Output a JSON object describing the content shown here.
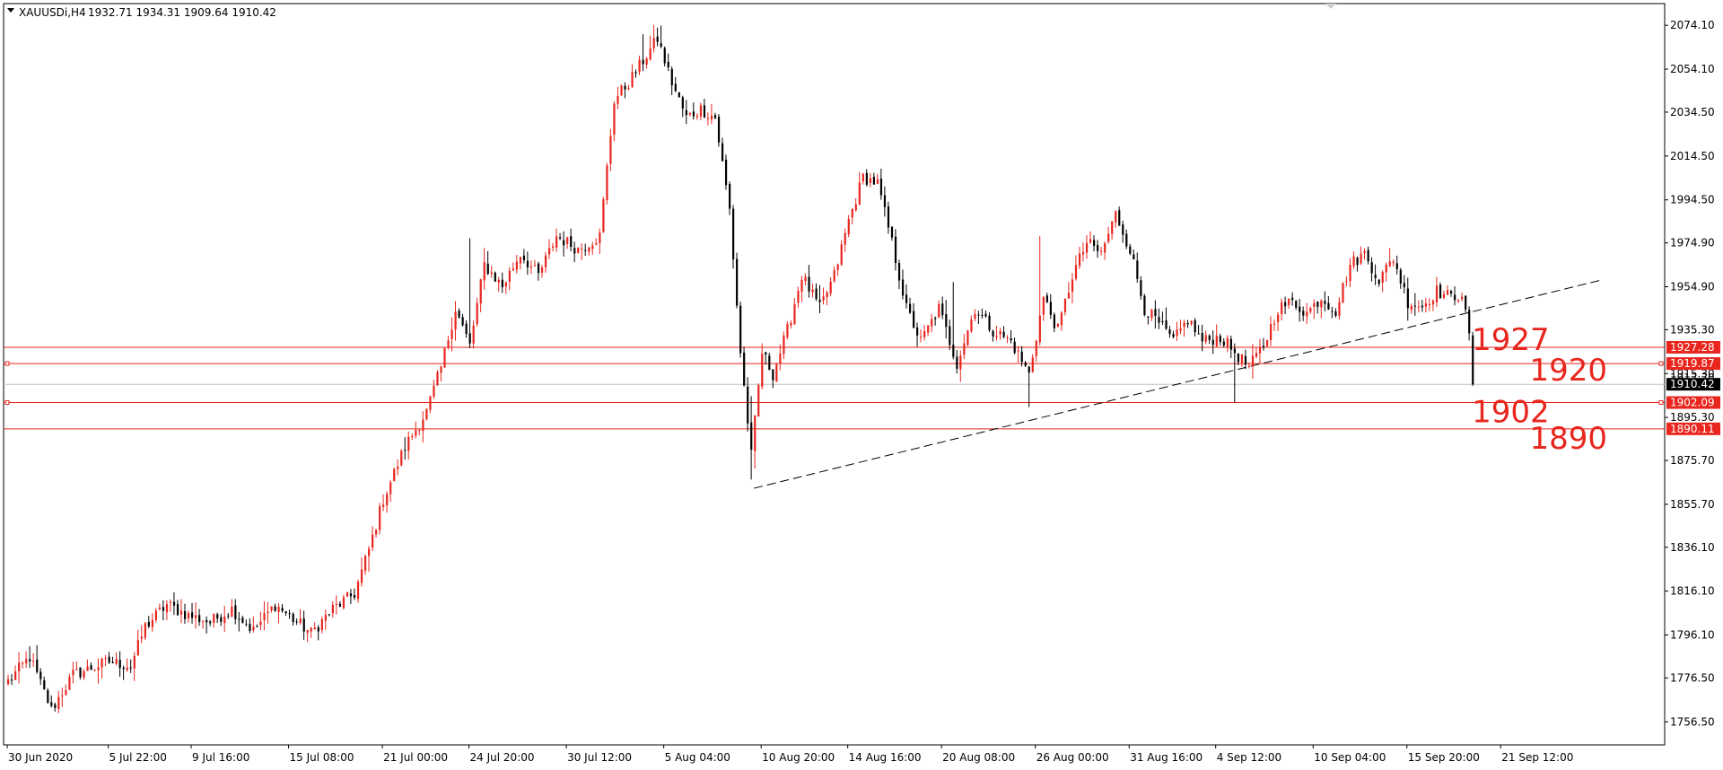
{
  "chart_data": {
    "type": "candlestick",
    "symbol_header": "XAUUSDi,H4",
    "ohlc_header": "1932.71 1934.31 1909.64 1910.42",
    "ylim": [
      1746.0,
      2084.0
    ],
    "y_ticks": [
      "2074.10",
      "2054.10",
      "2034.50",
      "2014.50",
      "1994.50",
      "1974.90",
      "1954.90",
      "1935.30",
      "1915.30",
      "1895.30",
      "1875.70",
      "1855.70",
      "1836.10",
      "1816.10",
      "1796.10",
      "1776.50",
      "1756.50"
    ],
    "x_ticks": [
      {
        "label": "30 Jun 2020",
        "bar": 0
      },
      {
        "label": "5 Jul 22:00",
        "bar": 28
      },
      {
        "label": "9 Jul 16:00",
        "bar": 51
      },
      {
        "label": "15 Jul 08:00",
        "bar": 78
      },
      {
        "label": "21 Jul 00:00",
        "bar": 104
      },
      {
        "label": "24 Jul 20:00",
        "bar": 128
      },
      {
        "label": "30 Jul 12:00",
        "bar": 155
      },
      {
        "label": "5 Aug 04:00",
        "bar": 182
      },
      {
        "label": "10 Aug 20:00",
        "bar": 209
      },
      {
        "label": "14 Aug 16:00",
        "bar": 233
      },
      {
        "label": "20 Aug 08:00",
        "bar": 259
      },
      {
        "label": "26 Aug 00:00",
        "bar": 285
      },
      {
        "label": "31 Aug 16:00",
        "bar": 311
      },
      {
        "label": "4 Sep 12:00",
        "bar": 335
      },
      {
        "label": "10 Sep 04:00",
        "bar": 362
      },
      {
        "label": "15 Sep 20:00",
        "bar": 388
      },
      {
        "label": "21 Sep 12:00",
        "bar": 414
      }
    ],
    "bar_count_visible": 450,
    "anchors": [
      {
        "i": 0,
        "p": 1775
      },
      {
        "i": 6,
        "p": 1786
      },
      {
        "i": 12,
        "p": 1762
      },
      {
        "i": 18,
        "p": 1778
      },
      {
        "i": 28,
        "p": 1784
      },
      {
        "i": 34,
        "p": 1782
      },
      {
        "i": 38,
        "p": 1800
      },
      {
        "i": 44,
        "p": 1810
      },
      {
        "i": 50,
        "p": 1805
      },
      {
        "i": 56,
        "p": 1802
      },
      {
        "i": 62,
        "p": 1808
      },
      {
        "i": 68,
        "p": 1798
      },
      {
        "i": 74,
        "p": 1810
      },
      {
        "i": 80,
        "p": 1802
      },
      {
        "i": 84,
        "p": 1797
      },
      {
        "i": 90,
        "p": 1808
      },
      {
        "i": 96,
        "p": 1815
      },
      {
        "i": 100,
        "p": 1835
      },
      {
        "i": 104,
        "p": 1858
      },
      {
        "i": 110,
        "p": 1882
      },
      {
        "i": 116,
        "p": 1898
      },
      {
        "i": 120,
        "p": 1918
      },
      {
        "i": 124,
        "p": 1945
      },
      {
        "i": 128,
        "p": 1928
      },
      {
        "i": 132,
        "p": 1965
      },
      {
        "i": 137,
        "p": 1955
      },
      {
        "i": 142,
        "p": 1970
      },
      {
        "i": 147,
        "p": 1960
      },
      {
        "i": 152,
        "p": 1978
      },
      {
        "i": 158,
        "p": 1972
      },
      {
        "i": 164,
        "p": 1978
      },
      {
        "i": 168,
        "p": 2040
      },
      {
        "i": 172,
        "p": 2048
      },
      {
        "i": 176,
        "p": 2058
      },
      {
        "i": 180,
        "p": 2068
      },
      {
        "i": 184,
        "p": 2048
      },
      {
        "i": 188,
        "p": 2032
      },
      {
        "i": 192,
        "p": 2036
      },
      {
        "i": 196,
        "p": 2032
      },
      {
        "i": 200,
        "p": 1990
      },
      {
        "i": 203,
        "p": 1925
      },
      {
        "i": 206,
        "p": 1878
      },
      {
        "i": 209,
        "p": 1925
      },
      {
        "i": 212,
        "p": 1915
      },
      {
        "i": 216,
        "p": 1935
      },
      {
        "i": 220,
        "p": 1960
      },
      {
        "i": 225,
        "p": 1945
      },
      {
        "i": 229,
        "p": 1960
      },
      {
        "i": 233,
        "p": 1985
      },
      {
        "i": 237,
        "p": 2005
      },
      {
        "i": 241,
        "p": 2002
      },
      {
        "i": 245,
        "p": 1975
      },
      {
        "i": 249,
        "p": 1945
      },
      {
        "i": 253,
        "p": 1930
      },
      {
        "i": 258,
        "p": 1945
      },
      {
        "i": 263,
        "p": 1920
      },
      {
        "i": 268,
        "p": 1945
      },
      {
        "i": 273,
        "p": 1935
      },
      {
        "i": 278,
        "p": 1930
      },
      {
        "i": 283,
        "p": 1915
      },
      {
        "i": 287,
        "p": 1950
      },
      {
        "i": 291,
        "p": 1935
      },
      {
        "i": 295,
        "p": 1960
      },
      {
        "i": 299,
        "p": 1975
      },
      {
        "i": 303,
        "p": 1970
      },
      {
        "i": 307,
        "p": 1988
      },
      {
        "i": 311,
        "p": 1972
      },
      {
        "i": 315,
        "p": 1945
      },
      {
        "i": 319,
        "p": 1938
      },
      {
        "i": 323,
        "p": 1930
      },
      {
        "i": 327,
        "p": 1940
      },
      {
        "i": 331,
        "p": 1930
      },
      {
        "i": 336,
        "p": 1932
      },
      {
        "i": 340,
        "p": 1925
      },
      {
        "i": 344,
        "p": 1918
      },
      {
        "i": 348,
        "p": 1928
      },
      {
        "i": 352,
        "p": 1945
      },
      {
        "i": 356,
        "p": 1948
      },
      {
        "i": 360,
        "p": 1943
      },
      {
        "i": 364,
        "p": 1950
      },
      {
        "i": 368,
        "p": 1944
      },
      {
        "i": 372,
        "p": 1965
      },
      {
        "i": 376,
        "p": 1970
      },
      {
        "i": 380,
        "p": 1958
      },
      {
        "i": 384,
        "p": 1968
      },
      {
        "i": 388,
        "p": 1948
      },
      {
        "i": 392,
        "p": 1946
      },
      {
        "i": 396,
        "p": 1953
      },
      {
        "i": 400,
        "p": 1950
      },
      {
        "i": 403,
        "p": 1952
      },
      {
        "i": 405,
        "p": 1932
      },
      {
        "i": 406,
        "p": 1910.42
      }
    ],
    "last_bar": {
      "i": 406,
      "open": 1932.71,
      "high": 1934.31,
      "low": 1909.64,
      "close": 1910.42
    },
    "horizontal_levels": [
      {
        "price": 1927.28,
        "tag": "1927.28",
        "marker": false
      },
      {
        "price": 1919.87,
        "tag": "1919.87",
        "marker": true
      },
      {
        "price": 1902.09,
        "tag": "1902.09",
        "marker": true
      },
      {
        "price": 1890.11,
        "tag": "1890.11",
        "marker": false
      }
    ],
    "current_price": {
      "price": 1910.42,
      "tag": "1910.42"
    },
    "current_price_shadow": "1913.30",
    "trendline": {
      "start": {
        "bar": 207,
        "price": 1863.0
      },
      "end": {
        "bar": 442,
        "price": 1958.0
      }
    },
    "annotations": [
      {
        "text": "1927",
        "bar": 406,
        "price": 1931
      },
      {
        "text": "1920",
        "bar": 422,
        "price": 1917
      },
      {
        "text": "1902",
        "bar": 406,
        "price": 1898
      },
      {
        "text": "1890",
        "bar": 422,
        "price": 1886
      }
    ],
    "colors": {
      "bull": "#e8261e",
      "bear": "#000000",
      "level": "#e8261e",
      "tag_bg": "#e8261e",
      "current_bg": "#000000",
      "annotation": "#e8261e",
      "trendline": "#000000",
      "axis": "#000000"
    }
  }
}
